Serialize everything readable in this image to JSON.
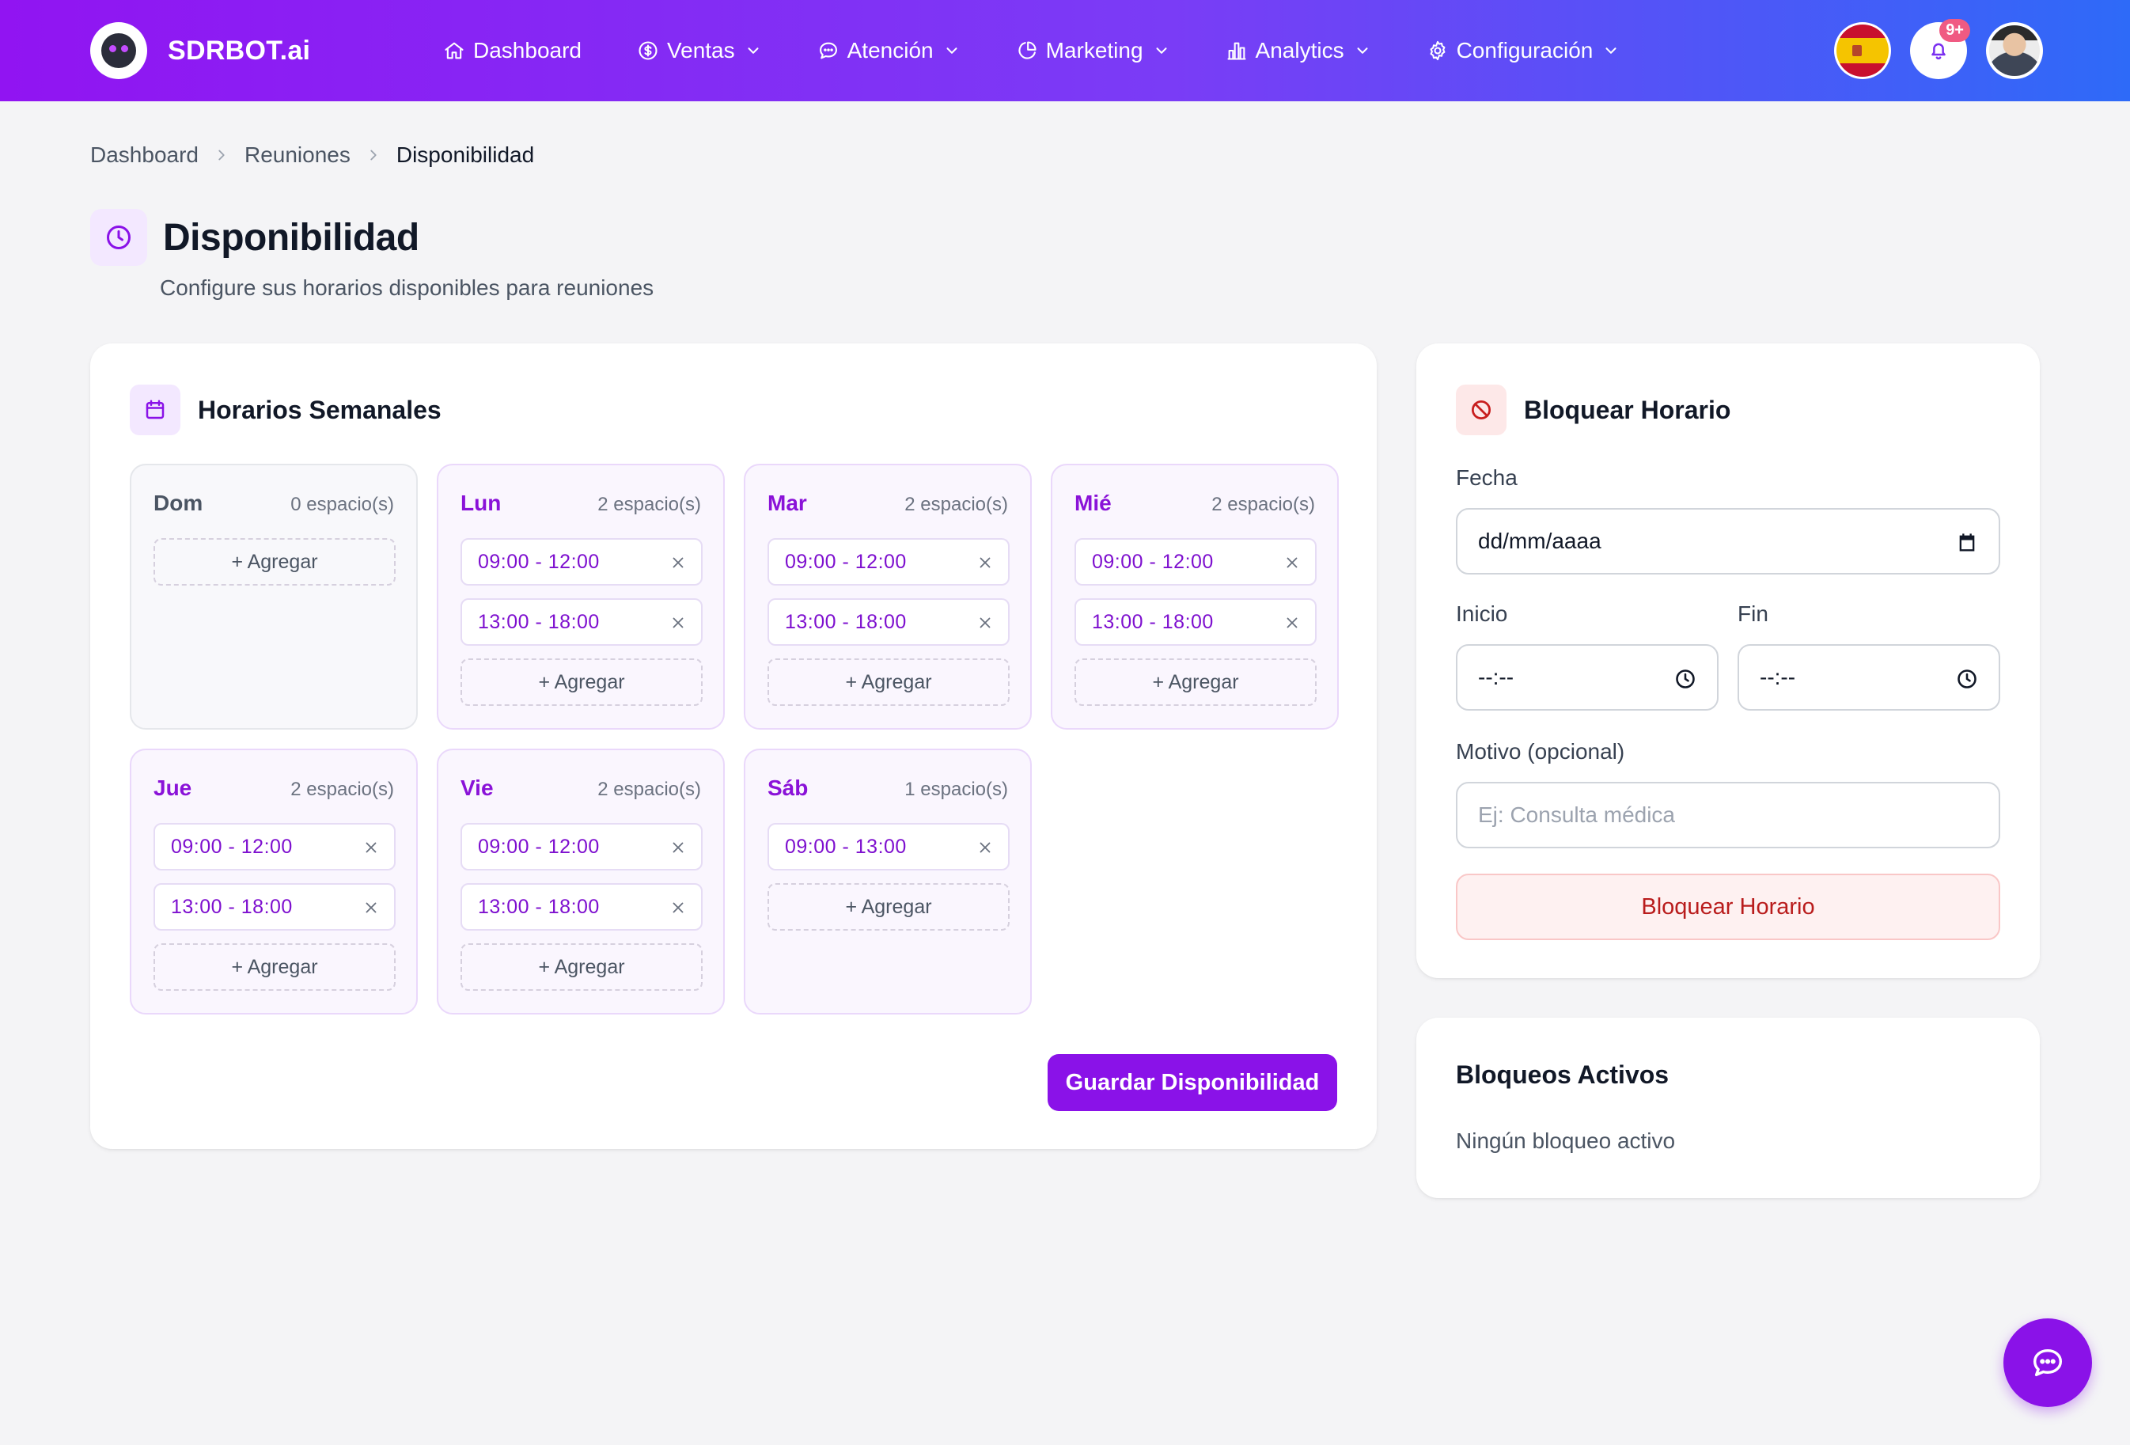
{
  "brand": {
    "name": "SDRBOT.ai"
  },
  "nav": [
    {
      "label": "Dashboard",
      "icon": "home-icon",
      "dropdown": false
    },
    {
      "label": "Ventas",
      "icon": "dollar-icon",
      "dropdown": true
    },
    {
      "label": "Atención",
      "icon": "chat-bubble-icon",
      "dropdown": true
    },
    {
      "label": "Marketing",
      "icon": "pie-chart-icon",
      "dropdown": true
    },
    {
      "label": "Analytics",
      "icon": "bar-chart-icon",
      "dropdown": true
    },
    {
      "label": "Configuración",
      "icon": "gear-icon",
      "dropdown": true
    }
  ],
  "header": {
    "notifications_badge": "9+",
    "language": "es"
  },
  "breadcrumb": [
    "Dashboard",
    "Reuniones",
    "Disponibilidad"
  ],
  "page": {
    "title": "Disponibilidad",
    "subtitle": "Configure sus horarios disponibles para reuniones"
  },
  "weekly": {
    "title": "Horarios Semanales",
    "add_label": "+ Agregar",
    "save_label": "Guardar Disponibilidad",
    "days": [
      {
        "name": "Dom",
        "count": "0 espacio(s)",
        "slots": []
      },
      {
        "name": "Lun",
        "count": "2 espacio(s)",
        "slots": [
          "09:00 - 12:00",
          "13:00 - 18:00"
        ]
      },
      {
        "name": "Mar",
        "count": "2 espacio(s)",
        "slots": [
          "09:00 - 12:00",
          "13:00 - 18:00"
        ]
      },
      {
        "name": "Mié",
        "count": "2 espacio(s)",
        "slots": [
          "09:00 - 12:00",
          "13:00 - 18:00"
        ]
      },
      {
        "name": "Jue",
        "count": "2 espacio(s)",
        "slots": [
          "09:00 - 12:00",
          "13:00 - 18:00"
        ]
      },
      {
        "name": "Vie",
        "count": "2 espacio(s)",
        "slots": [
          "09:00 - 12:00",
          "13:00 - 18:00"
        ]
      },
      {
        "name": "Sáb",
        "count": "1 espacio(s)",
        "slots": [
          "09:00 - 13:00"
        ]
      }
    ]
  },
  "block": {
    "title": "Bloquear Horario",
    "date_label": "Fecha",
    "date_value": "dd/mm/aaaa",
    "start_label": "Inicio",
    "start_value": "--:--",
    "end_label": "Fin",
    "end_value": "--:--",
    "reason_label": "Motivo (opcional)",
    "reason_placeholder": "Ej: Consulta médica",
    "button_label": "Bloquear Horario"
  },
  "active_blocks": {
    "title": "Bloqueos Activos",
    "empty_text": "Ningún bloqueo activo"
  },
  "colors": {
    "accent": "#8a12e8",
    "header_start": "#9114f2",
    "header_end": "#2e6af8",
    "danger": "#b91c1c"
  }
}
